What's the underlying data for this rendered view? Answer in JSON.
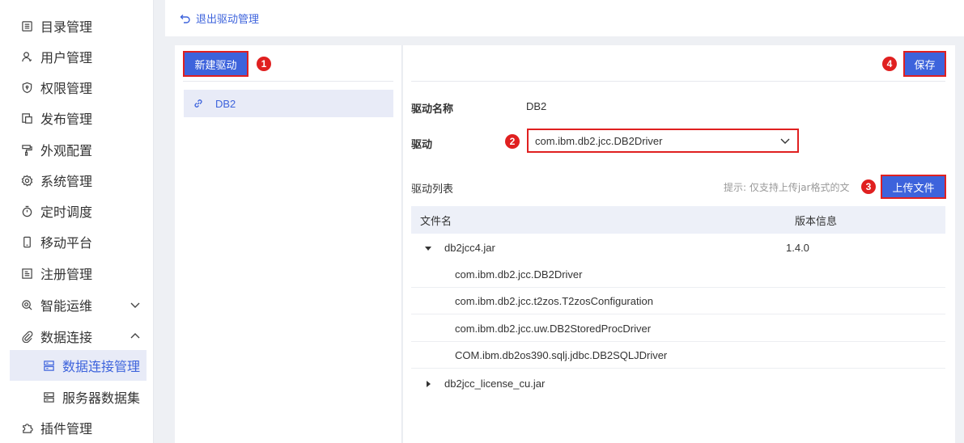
{
  "sidebar": {
    "items": [
      {
        "label": "目录管理",
        "icon": "catalog-icon"
      },
      {
        "label": "用户管理",
        "icon": "user-icon"
      },
      {
        "label": "权限管理",
        "icon": "shield-icon"
      },
      {
        "label": "发布管理",
        "icon": "publish-icon"
      },
      {
        "label": "外观配置",
        "icon": "paint-roller-icon"
      },
      {
        "label": "系统管理",
        "icon": "gear-icon"
      },
      {
        "label": "定时调度",
        "icon": "timer-icon"
      },
      {
        "label": "移动平台",
        "icon": "mobile-icon"
      },
      {
        "label": "注册管理",
        "icon": "register-icon"
      },
      {
        "label": "智能运维",
        "icon": "ops-icon"
      },
      {
        "label": "数据连接",
        "icon": "paperclip-icon"
      }
    ],
    "sub_items": [
      {
        "label": "数据连接管理",
        "icon": "database-icon"
      },
      {
        "label": "服务器数据集",
        "icon": "dataset-icon"
      }
    ],
    "last_item": {
      "label": "插件管理",
      "icon": "puzzle-icon"
    }
  },
  "topbar": {
    "back_label": "退出驱动管理"
  },
  "left_panel": {
    "new_button": "新建驱动",
    "drivers": [
      {
        "label": "DB2",
        "icon": "link-icon"
      }
    ]
  },
  "right_panel": {
    "save_button": "保存",
    "name_label": "驱动名称",
    "name_value": "DB2",
    "driver_label": "驱动",
    "driver_value": "com.ibm.db2.jcc.DB2Driver",
    "list_label": "驱动列表",
    "hint": "提示: 仅支持上传jar格式的文",
    "upload_button": "上传文件",
    "table": {
      "col_name": "文件名",
      "col_version": "版本信息",
      "rows": [
        {
          "name": "db2jcc4.jar",
          "version": "1.4.0",
          "expanded": true
        },
        {
          "name": "com.ibm.db2.jcc.DB2Driver"
        },
        {
          "name": "com.ibm.db2.jcc.t2zos.T2zosConfiguration"
        },
        {
          "name": "com.ibm.db2.jcc.uw.DB2StoredProcDriver"
        },
        {
          "name": "COM.ibm.db2os390.sqlj.jdbc.DB2SQLJDriver"
        },
        {
          "name": "db2jcc_license_cu.jar",
          "expanded": false
        }
      ]
    }
  },
  "markers": [
    "1",
    "2",
    "3",
    "4"
  ],
  "colors": {
    "accent": "#3d63dc",
    "marker": "#e02020"
  }
}
